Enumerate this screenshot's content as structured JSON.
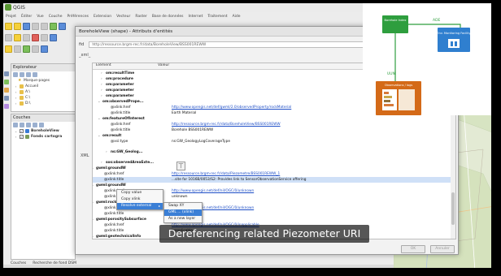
{
  "app": {
    "title": "QGIS"
  },
  "menubar": [
    "Projet",
    "Éditer",
    "Vue",
    "Couche",
    "Préférences",
    "Extension",
    "Vecteur",
    "Raster",
    "Base de données",
    "Internet",
    "Traitement",
    "Aide"
  ],
  "panels": {
    "browser": {
      "title": "Explorateur",
      "items": [
        {
          "label": "Marque-pages"
        },
        {
          "label": "Accueil"
        },
        {
          "label": "A:\\"
        },
        {
          "label": "C:\\"
        },
        {
          "label": "D:\\"
        }
      ]
    },
    "layers": {
      "title": "Couches",
      "items": [
        {
          "label": "BoreholeView"
        },
        {
          "label": "Fonds cartogra"
        }
      ]
    }
  },
  "bottom_tabs": [
    "Couches",
    "Recherche de fond DSM"
  ],
  "dialog": {
    "title": "BoreholeView (shape) - Attributs d'entités",
    "fid_label": "fid",
    "fid_value": "http://ressource.brgm-rec.fr/data/BoreholeView/BSS001REWW",
    "xml_label": "_xml_",
    "xml_side_label": "XML",
    "col_element": "Élément",
    "col_valeur": "Valeur",
    "ok_label": "OK",
    "cancel_label": "Annuler"
  },
  "tree_rows": [
    {
      "name": "om:resultTime",
      "value": ""
    },
    {
      "name": "om:procedure",
      "value": ""
    },
    {
      "name": "om:parameter",
      "value": ""
    },
    {
      "name": "om:parameter",
      "value": ""
    },
    {
      "name": "om:parameter",
      "value": ""
    },
    {
      "name": "om:observedPrope...",
      "value": ""
    },
    {
      "name": "@xlink:href",
      "value": "http://www.opengis.net/def/gwml/2.0/observedProperty/rockMaterial"
    },
    {
      "name": "@xlink:title",
      "value": "Earth Material"
    },
    {
      "name": "om:featureOfInterest",
      "value": ""
    },
    {
      "name": "@xlink:href",
      "value": "http://ressource.brgm-rec.fr/data/BoreholeView/BSS001REWW"
    },
    {
      "name": "@xlink:title",
      "value": "Borehole BSS001REWW"
    },
    {
      "name": "om:result",
      "value": ""
    },
    {
      "name": "@xsi:type",
      "value": "ns:GW_GeologyLogCoverageType"
    },
    {
      "name": "ns:GW_Geolog...",
      "value": ""
    },
    {
      "name": "sos:observedAreaExte...",
      "value": ""
    },
    {
      "name": "gwml:groundW",
      "value": ""
    },
    {
      "name": "@xlink:href",
      "value": "http://ressource.brgm-rec.fr/data/Piezometre/BSS001REWW_1"
    },
    {
      "name": "@xlink:title",
      "value": "...site for 1016B/0053/S2: Provides link to SensorObservationService offering"
    },
    {
      "name": "gwml:groundW",
      "value": ""
    },
    {
      "name": "@xlink:href",
      "value": "http://www.opengis.net/def/nil/OGC/0/unknown"
    },
    {
      "name": "@xlink:title",
      "value": "unknown"
    },
    {
      "name": "gwml:rockMineralisedh...",
      "value": ""
    },
    {
      "name": "@xlink:href",
      "value": "http://www.opengis.net/def/nil/OGC/0/unknown"
    },
    {
      "name": "@xlink:title",
      "value": "unknown"
    },
    {
      "name": "gwml:porositySubsurface",
      "value": ""
    },
    {
      "name": "@xlink:href",
      "value": "http://www.opengis.net/def/nil/OGC/0/inapplicable"
    },
    {
      "name": "@xlink:title",
      "value": "inapplicable"
    },
    {
      "name": "gwml:geotechnicalInfo",
      "value": ""
    },
    {
      "name": "@xlink:href",
      "value": "http://www.opengis.net/def/nil/OGC/0/unknown"
    },
    {
      "name": "@xlink:title",
      "value": "unknown"
    }
  ],
  "context_menu": {
    "items": [
      "Copy value",
      "Copy xlink",
      "Resolve external"
    ]
  },
  "submenu": {
    "items": [
      "Swap XY",
      "GML ... (xlink)",
      "As a new layer"
    ]
  },
  "map": {
    "nodes": [
      {
        "label": "Borehole Index",
        "color": "#2e9e3e"
      },
      {
        "label": "Env. Monitoring Facility",
        "color": "#2f7fcf"
      },
      {
        "label": "Observations / logs",
        "color": "#d46a18"
      }
    ],
    "edge_labels": [
      "ADE",
      "UUN"
    ]
  },
  "caption": "Dereferencing related Piezometer URI"
}
